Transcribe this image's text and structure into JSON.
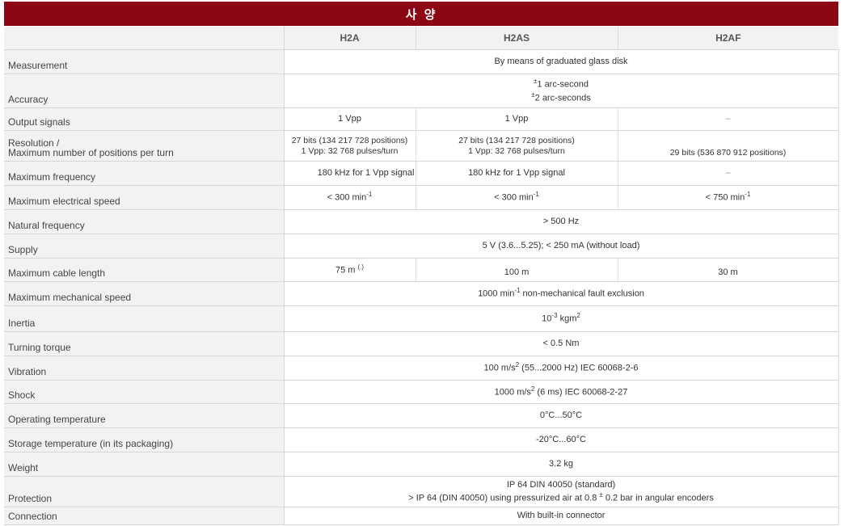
{
  "title": "사 양",
  "columns": [
    "H2A",
    "H2AS",
    "H2AF"
  ],
  "rows": {
    "measurement": {
      "label": "Measurement",
      "value": "By means of graduated glass disk"
    },
    "accuracy": {
      "label": "Accuracy",
      "line1_pm": "±",
      "line1": "1 arc-second",
      "line2_pm": "±",
      "line2": "2 arc-seconds"
    },
    "output": {
      "label": "Output signals",
      "h2a": "1 Vpp",
      "h2as": "1 Vpp",
      "h2af": "–"
    },
    "resolution": {
      "label1": "Resolution /",
      "label2": "Maximum number of positions per turn",
      "h2a_1": "27 bits (134 217 728 positions)",
      "h2a_2": "1 Vpp: 32 768 pulses/turn",
      "h2as_1": "27 bits (134 217 728 positions)",
      "h2as_2": "1 Vpp: 32 768 pulses/turn",
      "h2af": "29 bits (536 870 912 positions)"
    },
    "max_freq": {
      "label": "Maximum frequency",
      "h2a": "180 kHz for 1 Vpp signal",
      "h2as": "180 kHz for 1 Vpp signal",
      "h2af": "–"
    },
    "elec_speed": {
      "label": "Maximum electrical speed",
      "h2a": "< 300 min",
      "h2as": "< 300 min",
      "h2af": "< 750 min",
      "sup": "-1"
    },
    "natural_freq": {
      "label": "Natural frequency",
      "value": "> 500 Hz"
    },
    "supply": {
      "label": "Supply",
      "value": "5 V (3.6...5.25); < 250 mA (without load)"
    },
    "cable": {
      "label": "Maximum cable length",
      "h2a": "75 m",
      "h2a_note": "(.)",
      "h2as": "100 m",
      "h2af": "30 m"
    },
    "mech_speed": {
      "label": "Maximum mechanical speed",
      "v1": "1000 min",
      "sup": "-1",
      "v2": " non-mechanical fault exclusion"
    },
    "inertia": {
      "label": "Inertia",
      "v1": "10",
      "sup1": "-3",
      "v2": " kgm",
      "sup2": "2"
    },
    "torque": {
      "label": "Turning torque",
      "value": "< 0.5 Nm"
    },
    "vibration": {
      "label": "Vibration",
      "v1": "100 m/s",
      "sup": "2",
      "v2": " (55...2000 Hz) IEC 60068-2-6"
    },
    "shock": {
      "label": "Shock",
      "v1": "1000 m/s",
      "sup": "2",
      "v2": " (6 ms) IEC 60068-2-27"
    },
    "op_temp": {
      "label": "Operating temperature",
      "value": "0°C...50°C"
    },
    "storage_temp": {
      "label": "Storage temperature (in its packaging)",
      "value": "-20°C...60°C"
    },
    "weight": {
      "label": "Weight",
      "value": "3.2 kg"
    },
    "protection": {
      "label": "Protection",
      "line1": "IP 64 DIN 40050 (standard)",
      "line2a": "> IP 64 (DIN 40050) using pressurized air at 0.8 ",
      "pm": "±",
      "line2b": " 0.2 bar in angular encoders"
    },
    "connection": {
      "label": "Connection",
      "value": "With built-in connector"
    }
  },
  "colors": {
    "title_bg": "#8b0713",
    "label_bg": "#f2f2f2",
    "border": "#d6d6d6"
  }
}
